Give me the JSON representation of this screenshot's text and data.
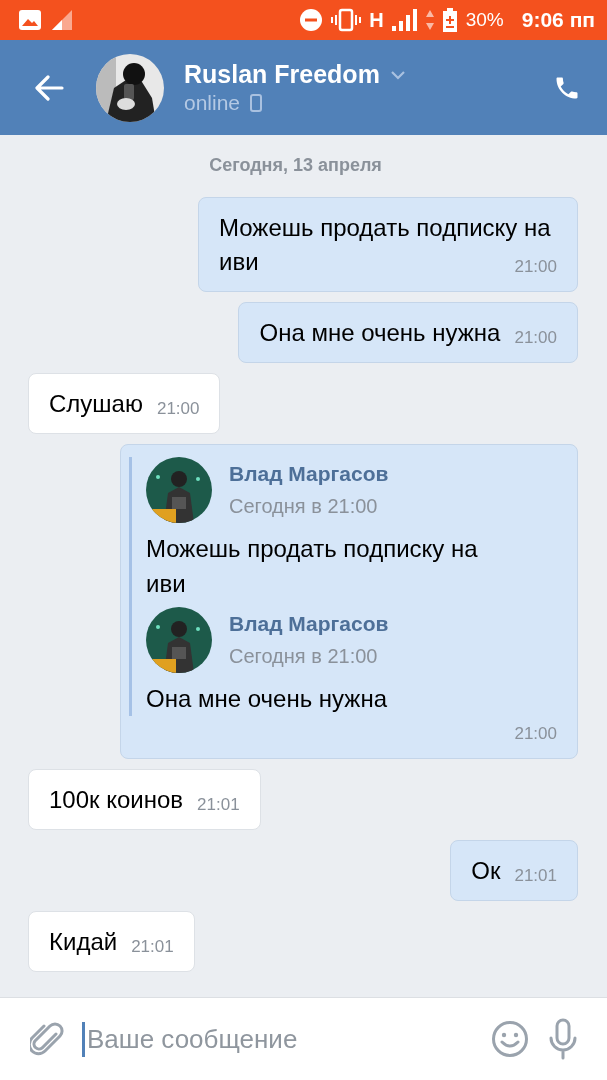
{
  "status_bar": {
    "network": "H",
    "battery": "30%",
    "time": "9:06 пп"
  },
  "header": {
    "name": "Ruslan Freedom",
    "status": "online"
  },
  "date_divider": "Сегодня, 13 апреля",
  "messages": [
    {
      "kind": "out",
      "text": "Можешь продать подписку на иви",
      "time": "21:00"
    },
    {
      "kind": "out",
      "text": "Она мне очень нужна",
      "time": "21:00"
    },
    {
      "kind": "in",
      "text": "Слушаю",
      "time": "21:00"
    },
    {
      "kind": "forward",
      "time": "21:00",
      "forwards": [
        {
          "author": "Влад Маргасов",
          "date": "Сегодня в 21:00",
          "text": "Можешь продать подписку на иви"
        },
        {
          "author": "Влад Маргасов",
          "date": "Сегодня в 21:00",
          "text": "Она мне очень нужна"
        }
      ]
    },
    {
      "kind": "in",
      "text": "100к коинов",
      "time": "21:01"
    },
    {
      "kind": "out",
      "text": "Ок",
      "time": "21:01"
    },
    {
      "kind": "in",
      "text": "Кидай",
      "time": "21:01"
    }
  ],
  "composer": {
    "placeholder": "Ваше сообщение"
  }
}
